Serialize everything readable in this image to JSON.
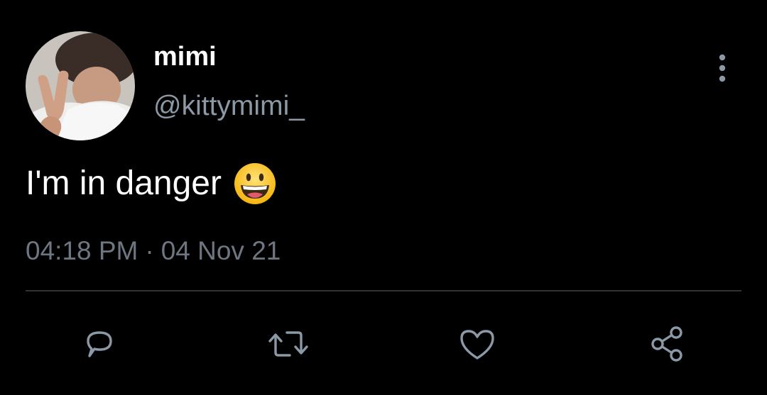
{
  "user": {
    "display_name": "mimi",
    "handle": "@kittymimi_",
    "avatar_icon": "profile-photo"
  },
  "tweet": {
    "text": "I'm in danger",
    "emoji_icon": "grinning-face-emoji"
  },
  "meta": {
    "time": "04:18 PM",
    "separator": "·",
    "date": "04 Nov 21"
  },
  "actions": {
    "reply_icon": "reply-icon",
    "retweet_icon": "retweet-icon",
    "like_icon": "heart-icon",
    "share_icon": "share-icon"
  },
  "colors": {
    "background": "#000000",
    "primary_text": "#ffffff",
    "secondary_text": "#8b98a5",
    "divider": "#2f3336",
    "icon": "#8b98a5"
  }
}
